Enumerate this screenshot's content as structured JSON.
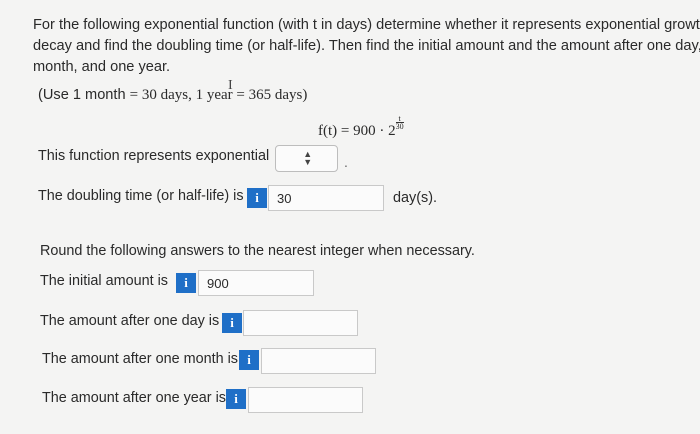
{
  "prompt": {
    "line1": "For the following exponential function (with t in days) determine whether it represents exponential growth o",
    "line2": "decay and find the doubling time (or half-life). Then find the initial amount and the amount after one day, one",
    "line3": "month, and one year."
  },
  "note": {
    "open": "(Use 1 month ",
    "eq1": "= 30 days, 1 year",
    "eq2": " = 365 days)"
  },
  "formula": {
    "lhs": "f(t) = 900 · 2",
    "exp_num": "t",
    "exp_den": "30"
  },
  "growth_decay": {
    "label": "This function represents exponential",
    "selected": ""
  },
  "doubling": {
    "label": "The doubling time (or half-life) is",
    "value": "30",
    "unit": "day(s)."
  },
  "round_instruction": "Round the following answers to the nearest integer when necessary.",
  "initial": {
    "label": "The initial amount is",
    "value": "900"
  },
  "one_day": {
    "label": "The amount after one day is",
    "value": ""
  },
  "one_month": {
    "label": "The amount after one month is",
    "value": ""
  },
  "one_year": {
    "label": "The amount after one year is",
    "value": ""
  },
  "info_glyph": "i"
}
